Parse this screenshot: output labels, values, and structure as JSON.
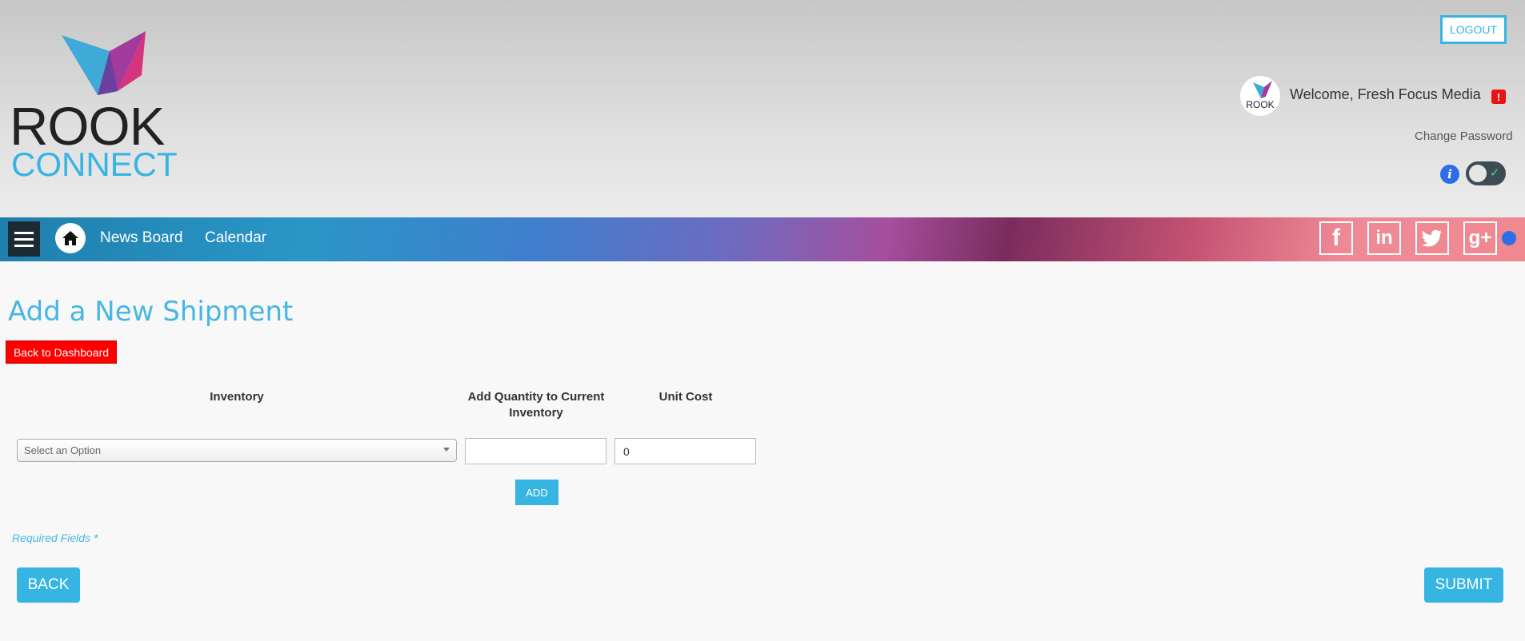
{
  "brand": {
    "line1": "ROOK",
    "line2": "CONNECT"
  },
  "header": {
    "logout_label": "LOGOUT",
    "welcome": "Welcome, Fresh Focus Media",
    "alert_badge": "!",
    "change_password": "Change Password",
    "info_glyph": "i",
    "toggle_check": "✓"
  },
  "nav": {
    "news_board": "News Board",
    "calendar": "Calendar",
    "social": {
      "facebook": "f",
      "linkedin": "in",
      "twitter": "🐦",
      "googleplus": "g+"
    }
  },
  "main": {
    "title": "Add a New Shipment",
    "back_to_dashboard": "Back to Dashboard",
    "columns": {
      "inventory": "Inventory",
      "add_quantity": "Add Quantity to Current Inventory",
      "unit_cost": "Unit Cost"
    },
    "inventory_select": {
      "placeholder": "Select an Option"
    },
    "quantity_value": "",
    "unit_cost_value": "0",
    "add_label": "ADD",
    "required_note": "Required Fields *",
    "back_label": "BACK",
    "submit_label": "SUBMIT"
  },
  "colors": {
    "accent": "#36b5e3",
    "title": "#47b6e4",
    "danger": "#ff0000",
    "dark": "#1c2a33"
  }
}
